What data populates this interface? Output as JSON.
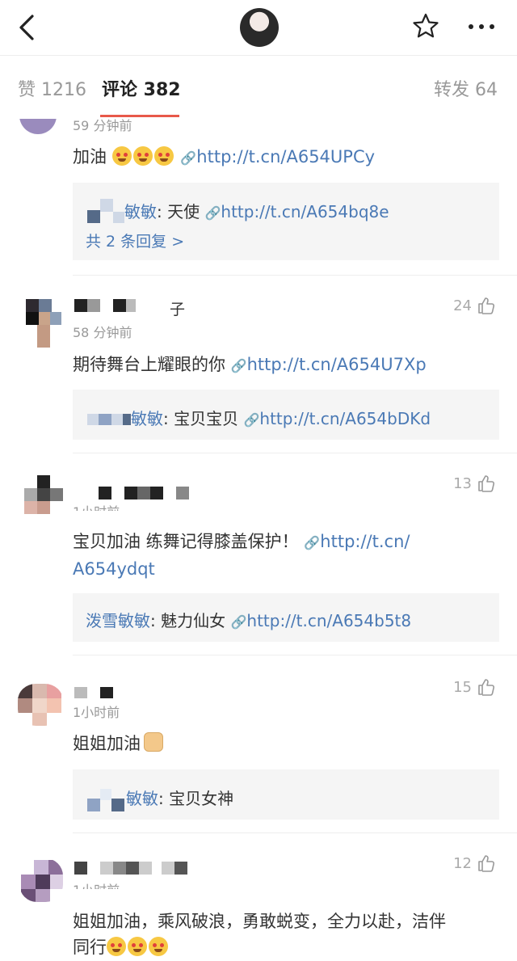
{
  "header": {
    "back_icon": "chevron-left-icon",
    "star_icon": "star-outline-icon",
    "more_icon": "more-dots-icon"
  },
  "tabs": {
    "like": "赞 1216",
    "comment": "评论 382",
    "repost": "转发 64"
  },
  "comments": [
    {
      "time": "59 分钟前",
      "text": "加油",
      "link": "http://t.cn/A654UPCy",
      "replies": [
        {
          "name": "敏敏",
          "sep": ": ",
          "text": "天使",
          "link": "http://t.cn/A654bq8e"
        }
      ],
      "more_replies": "共 2 条回复 >"
    },
    {
      "username": "子",
      "time": "58 分钟前",
      "likes": "24",
      "text": "期待舞台上耀眼的你",
      "link": "http://t.cn/A654U7Xp",
      "replies": [
        {
          "name": "敏敏",
          "sep": ": ",
          "text": "宝贝宝贝",
          "link": "http://t.cn/A654bDKd"
        }
      ]
    },
    {
      "time": "1小时前",
      "likes": "13",
      "text": "宝贝加油 练舞记得膝盖保护！",
      "link_part1": "http://t.cn/",
      "link_part2": "A654ydqt",
      "replies": [
        {
          "name": "泼雪敏敏",
          "sep": ": ",
          "text": "魅力仙女",
          "link": "http://t.cn/A654b5t8"
        }
      ]
    },
    {
      "time": "1小时前",
      "likes": "15",
      "text": "姐姐加油",
      "replies": [
        {
          "name": "敏敏",
          "sep": ": ",
          "text": "宝贝女神"
        }
      ]
    },
    {
      "time": "1小时前",
      "likes": "12",
      "text_line1": "姐姐加油，乘风破浪，勇敢蜕变，全力以赴，洁伴",
      "text_line2": "同行"
    }
  ]
}
